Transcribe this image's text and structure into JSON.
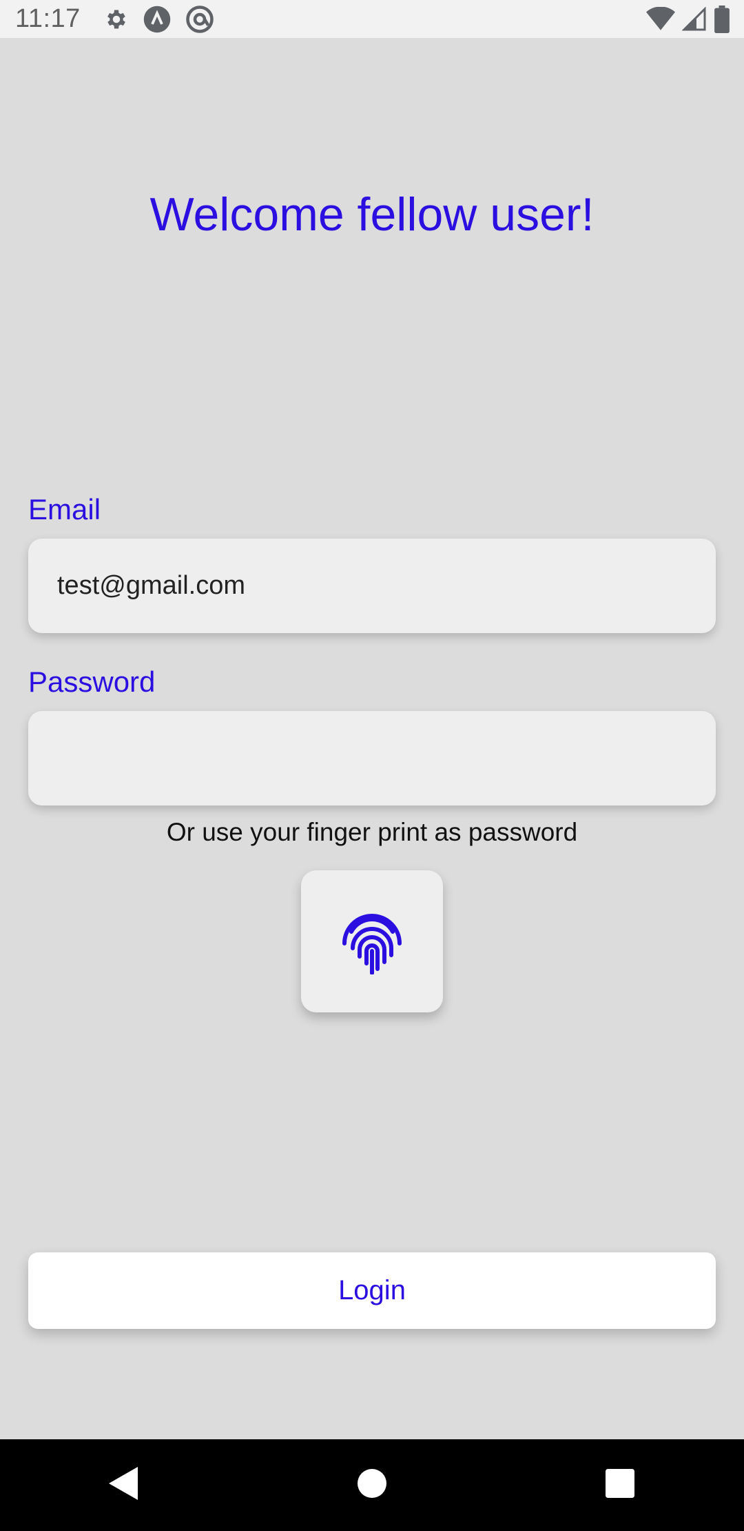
{
  "status_bar": {
    "time": "11:17",
    "left_icons": [
      "settings-icon",
      "app-icon",
      "at-sign-icon"
    ],
    "right_icons": [
      "wifi-icon",
      "signal-icon",
      "battery-icon"
    ]
  },
  "welcome_title": "Welcome fellow user!",
  "email": {
    "label": "Email",
    "value": "test@gmail.com"
  },
  "password": {
    "label": "Password",
    "value": ""
  },
  "fingerprint_hint": "Or use your finger print as password",
  "fingerprint_button": {
    "icon": "fingerprint-icon"
  },
  "login_button": {
    "label": "Login"
  },
  "nav_bar": {
    "buttons": [
      "back",
      "home",
      "recents"
    ]
  },
  "colors": {
    "accent": "#2a0fe0",
    "background": "#dcdcdc",
    "field": "#eeeeee"
  }
}
